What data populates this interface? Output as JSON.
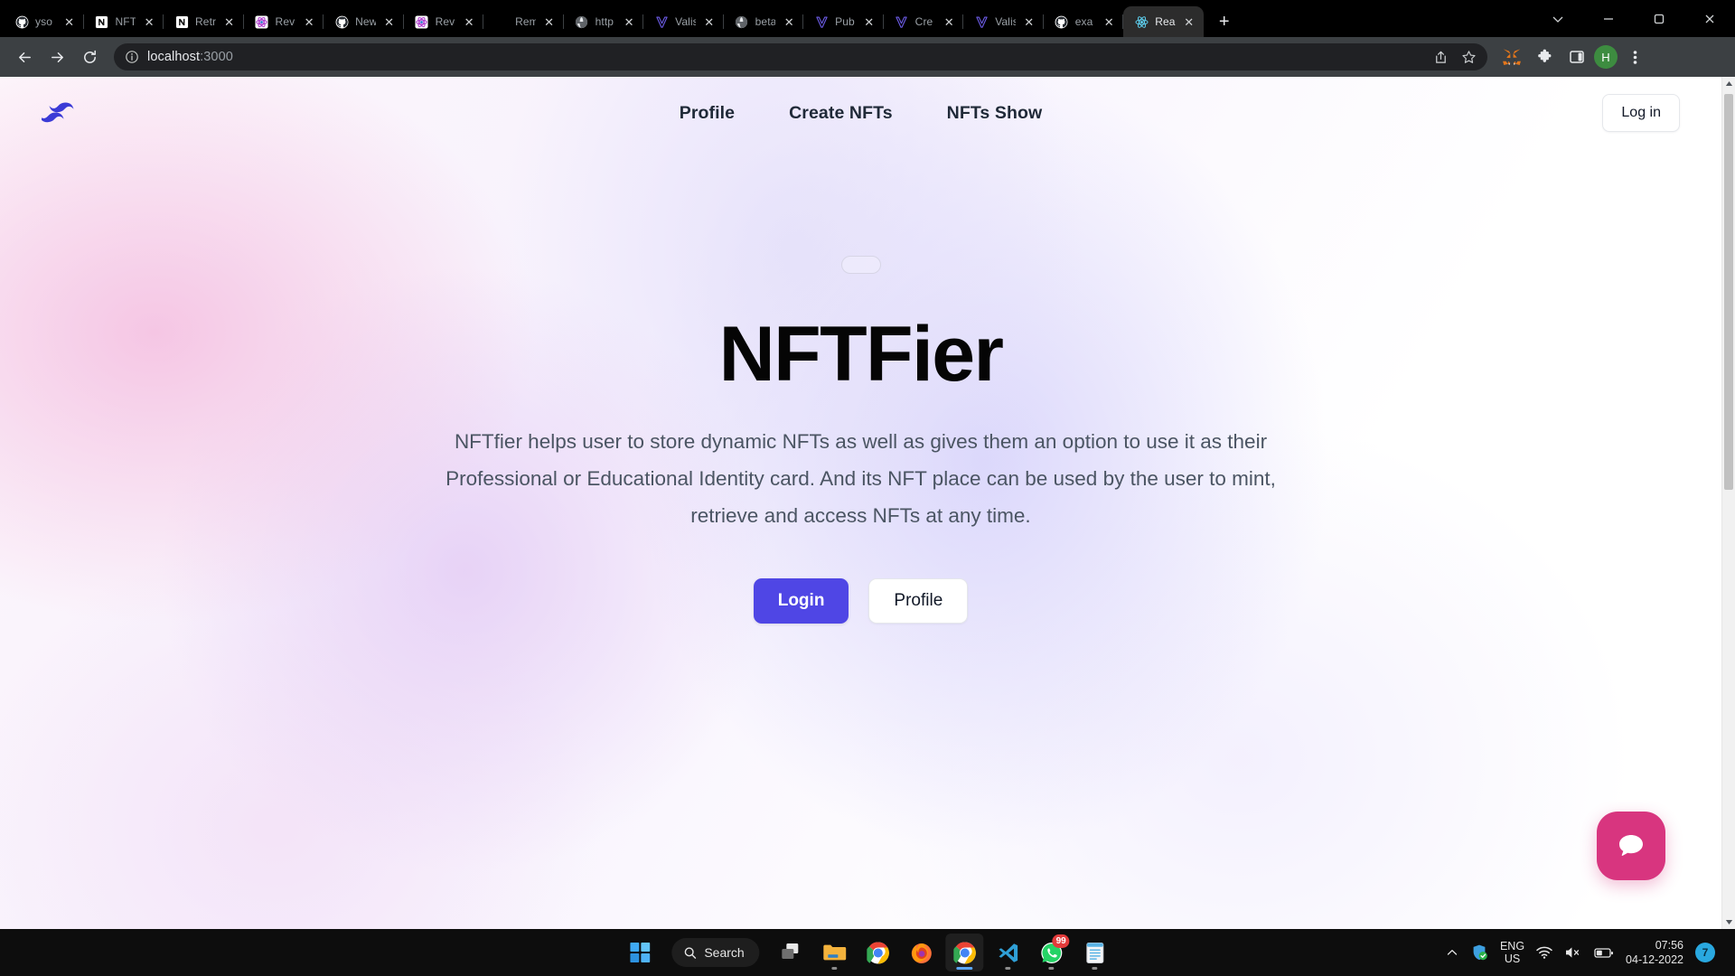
{
  "browser": {
    "tabs": [
      {
        "label": "yso",
        "icon": "github-icon",
        "active": false
      },
      {
        "label": "NFT",
        "icon": "notion-icon",
        "active": false
      },
      {
        "label": "Retr",
        "icon": "notion-icon",
        "active": false
      },
      {
        "label": "Rev",
        "icon": "openai-icon",
        "active": false
      },
      {
        "label": "New",
        "icon": "github-icon",
        "active": false
      },
      {
        "label": "Rev",
        "icon": "openai-icon",
        "active": false
      },
      {
        "label": "Rem",
        "icon": "blank-icon",
        "active": false
      },
      {
        "label": "http",
        "icon": "globe-icon",
        "active": false
      },
      {
        "label": "Valis",
        "icon": "vercel-icon",
        "active": false
      },
      {
        "label": "beta",
        "icon": "globe-icon",
        "active": false
      },
      {
        "label": "Pub",
        "icon": "vercel-icon",
        "active": false
      },
      {
        "label": "Cre",
        "icon": "vercel-icon",
        "active": false
      },
      {
        "label": "Valis",
        "icon": "vercel-icon",
        "active": false
      },
      {
        "label": "exa",
        "icon": "github-icon",
        "active": false
      },
      {
        "label": "Rea",
        "icon": "react-icon",
        "active": true
      }
    ],
    "tab_close_label": "✕",
    "new_tab_label": "+",
    "window_controls": {
      "tab_search": "chevron-down-icon",
      "minimize": "minimize-icon",
      "maximize": "maximize-icon",
      "close": "close-icon"
    },
    "toolbar": {
      "back": "back-arrow-icon",
      "forward": "forward-arrow-icon",
      "reload": "reload-icon",
      "site_info": "info-circle-icon",
      "url_host": "localhost",
      "url_port": ":3000",
      "share": "share-icon",
      "bookmark": "star-icon",
      "metamask": "metamask-fox-icon",
      "extensions": "puzzle-piece-icon",
      "sidepanel": "side-panel-icon",
      "profile_initial": "H",
      "menu": "three-dot-menu-icon"
    }
  },
  "page": {
    "nav": {
      "logo": "wave-logo-icon",
      "links": [
        {
          "label": "Profile"
        },
        {
          "label": "Create NFTs"
        },
        {
          "label": "NFTs Show"
        }
      ],
      "login_label": "Log in"
    },
    "hero": {
      "badge_pill": "",
      "title": "NFTFier",
      "description": "NFTfier helps user to store dynamic NFTs as well as gives them an option to use it as their Professional or Educational Identity card. And its NFT place can be used by the user to mint, retrieve and access NFTs at any time.",
      "primary_button": "Login",
      "secondary_button": "Profile"
    },
    "chat_widget": {
      "icon": "chat-bubble-icon",
      "color": "#d8357f"
    },
    "colors": {
      "accent": "#4f46e5",
      "logo": "#3b3bd6",
      "chat": "#d8357f"
    }
  },
  "taskbar": {
    "start": "windows-start-icon",
    "search_placeholder": "Search",
    "items": [
      {
        "name": "task-view-icon",
        "badge": null,
        "active": false,
        "running": false
      },
      {
        "name": "file-explorer-icon",
        "badge": null,
        "active": false,
        "running": true
      },
      {
        "name": "chrome-icon",
        "badge": null,
        "active": false,
        "running": false
      },
      {
        "name": "firefox-icon",
        "badge": null,
        "active": false,
        "running": false
      },
      {
        "name": "chrome-active-icon",
        "badge": null,
        "active": true,
        "running": true
      },
      {
        "name": "vscode-icon",
        "badge": null,
        "active": false,
        "running": true
      },
      {
        "name": "whatsapp-icon",
        "badge": "99",
        "active": false,
        "running": true
      },
      {
        "name": "notepad-icon",
        "badge": null,
        "active": false,
        "running": true
      }
    ],
    "tray": {
      "overflow": "chevron-up-icon",
      "defender": "shield-check-icon",
      "lang_top": "ENG",
      "lang_bottom": "US",
      "wifi": "wifi-icon",
      "volume": "volume-muted-icon",
      "battery": "battery-icon",
      "time": "07:56",
      "date": "04-12-2022",
      "notification_count": "7"
    }
  }
}
